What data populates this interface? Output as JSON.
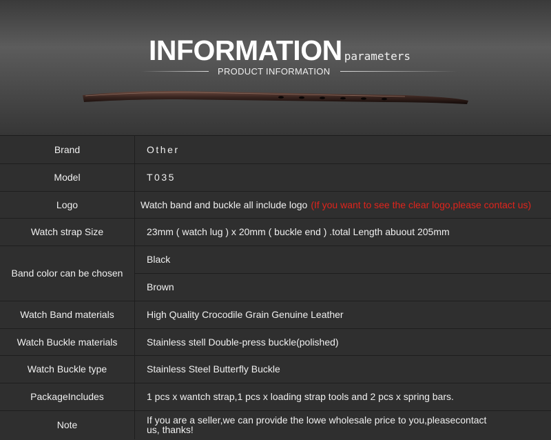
{
  "header": {
    "title": "INFORMATION",
    "title_suffix": "parameters",
    "subtitle": "PRODUCT INFORMATION"
  },
  "rows": {
    "brand": {
      "label": "Brand",
      "value": "Other"
    },
    "model": {
      "label": "Model",
      "value": "T035"
    },
    "logo": {
      "label": "Logo",
      "value": "Watch band and buckle all include logo",
      "note": "(If you want to see the clear logo,please contact us)"
    },
    "strap_size": {
      "label": "Watch strap Size",
      "value": "23mm ( watch lug ) x 20mm ( buckle end ) .total Length abuout 205mm"
    },
    "band_color": {
      "label": "Band color can be chosen",
      "options": [
        "Black",
        "Brown"
      ]
    },
    "band_materials": {
      "label": "Watch Band materials",
      "value": "High Quality Crocodile Grain Genuine Leather"
    },
    "buckle_materials": {
      "label": "Watch Buckle materials",
      "value": "Stainless stell Double-press buckle(polished)"
    },
    "buckle_type": {
      "label": "Watch Buckle type",
      "value": "Stainless Steel Butterfly Buckle"
    },
    "package": {
      "label": "PackageIncludes",
      "value": "1 pcs x wantch strap,1 pcs x loading strap tools and 2 pcs x spring bars."
    },
    "note": {
      "label": "Note",
      "value_line1": "If you are a seller,we can provide the lowe wholesale price to you,pleasecontact",
      "value_line2": "us, thanks!"
    }
  },
  "colors": {
    "background": "#2f2f2f",
    "text": "#f0f0f0",
    "accent_red": "#e1241c"
  }
}
